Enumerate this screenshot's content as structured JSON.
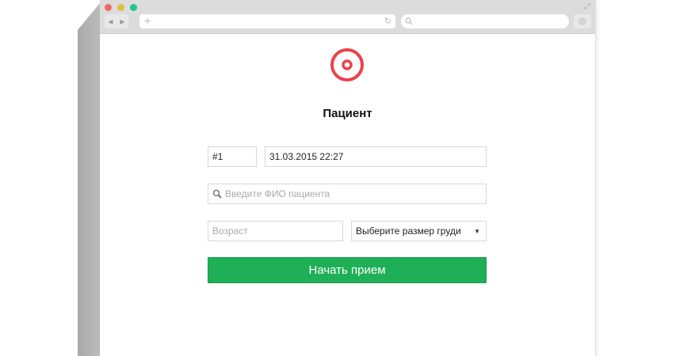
{
  "title": "Пациент",
  "patient_number": "#1",
  "datetime": "31.03.2015 22:27",
  "name_placeholder": "Введите ФИО пациента",
  "age_placeholder": "Возраст",
  "size_select": "Выберите размер груди",
  "submit": "Начать прием",
  "colors": {
    "accent": "#e8434b",
    "button": "#1faf57"
  }
}
